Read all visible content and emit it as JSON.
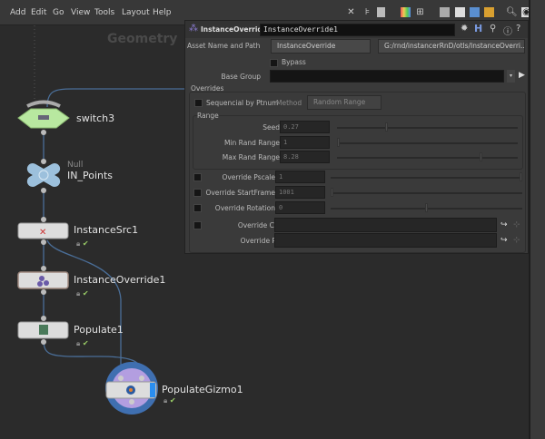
{
  "menu": [
    "Add",
    "Edit",
    "Go",
    "View",
    "Tools",
    "Layout",
    "Help"
  ],
  "network": {
    "context_label": "Geometry",
    "nodes": [
      {
        "name": "switch3"
      },
      {
        "type": "Null",
        "name": "IN_Points"
      },
      {
        "name": "InstanceSrc1"
      },
      {
        "name": "InstanceOverride1"
      },
      {
        "name": "Populate1"
      },
      {
        "name": "PopulateGizmo1"
      }
    ]
  },
  "params": {
    "node_type": "InstanceOverride",
    "node_name": "InstanceOverride1",
    "asset_label": "Asset Name and Path",
    "asset_name": "InstanceOverride",
    "asset_path": "G:/rnd/instancerRnD/otls/InstanceOverri...",
    "bypass": "Bypass",
    "base_group_label": "Base Group",
    "base_group": "",
    "overrides": "Overrides",
    "sequencial": "Sequencial by Ptnum",
    "method_label": "Method",
    "method": "Random Range",
    "range": "Range",
    "seed_label": "Seed",
    "seed": "0.27",
    "seed_frac": 0.27,
    "min_label": "Min Rand Range",
    "min": "1",
    "min_frac": 0,
    "max_label": "Max Rand Range",
    "max": "8.28",
    "max_frac": 0.8,
    "pscale_label": "Override Pscale",
    "pscale": "1",
    "pscale_frac": 1,
    "startframe_label": "Override StartFrame",
    "startframe": "1001",
    "startframe_frac": 0,
    "rotation_label": "Override Rotation",
    "rotation": "0",
    "rotation_frac": 0.5,
    "cache_label": "Override Cache",
    "cache": "",
    "proxy_label": "Override Proxy",
    "proxy": ""
  }
}
